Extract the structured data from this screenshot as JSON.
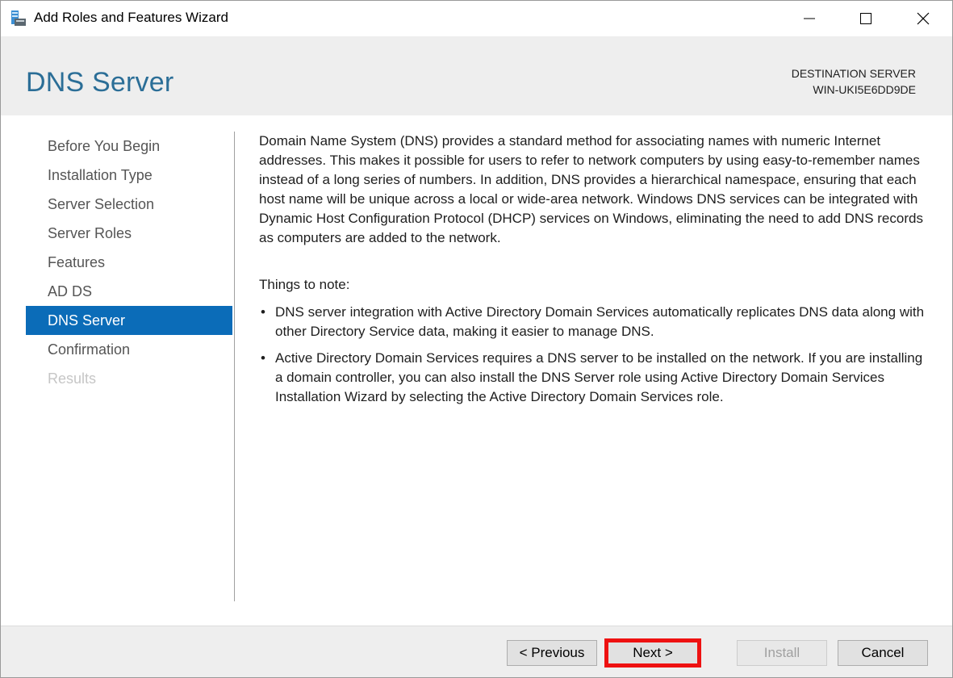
{
  "window": {
    "title": "Add Roles and Features Wizard",
    "icon": "server-manager-icon"
  },
  "header": {
    "page_title": "DNS Server",
    "destination_label": "DESTINATION SERVER",
    "destination_server": "WIN-UKI5E6DD9DE"
  },
  "nav": {
    "items": [
      {
        "label": "Before You Begin",
        "state": "normal"
      },
      {
        "label": "Installation Type",
        "state": "normal"
      },
      {
        "label": "Server Selection",
        "state": "normal"
      },
      {
        "label": "Server Roles",
        "state": "normal"
      },
      {
        "label": "Features",
        "state": "normal"
      },
      {
        "label": "AD DS",
        "state": "normal"
      },
      {
        "label": "DNS Server",
        "state": "active"
      },
      {
        "label": "Confirmation",
        "state": "normal"
      },
      {
        "label": "Results",
        "state": "disabled"
      }
    ]
  },
  "main": {
    "intro": "Domain Name System (DNS) provides a standard method for associating names with numeric Internet addresses. This makes it possible for users to refer to network computers by using easy-to-remember names instead of a long series of numbers. In addition, DNS provides a hierarchical namespace, ensuring that each host name will be unique across a local or wide-area network. Windows DNS services can be integrated with Dynamic Host Configuration Protocol (DHCP) services on Windows, eliminating the need to add DNS records as computers are added to the network.",
    "notes_heading": "Things to note:",
    "bullets": [
      "DNS server integration with Active Directory Domain Services automatically replicates DNS data along with other Directory Service data, making it easier to manage DNS.",
      "Active Directory Domain Services requires a DNS server to be installed on the network. If you are installing a domain controller, you can also install the DNS Server role using Active Directory Domain Services Installation Wizard by selecting the Active Directory Domain Services role."
    ],
    "bullet_glyph": "•"
  },
  "footer": {
    "previous_label": "< Previous",
    "next_label": "Next >",
    "install_label": "Install",
    "cancel_label": "Cancel"
  },
  "colors": {
    "accent": "#0b6cb8",
    "title": "#2b6e97",
    "highlight": "#ee1111",
    "header_bg": "#eeeeee"
  }
}
